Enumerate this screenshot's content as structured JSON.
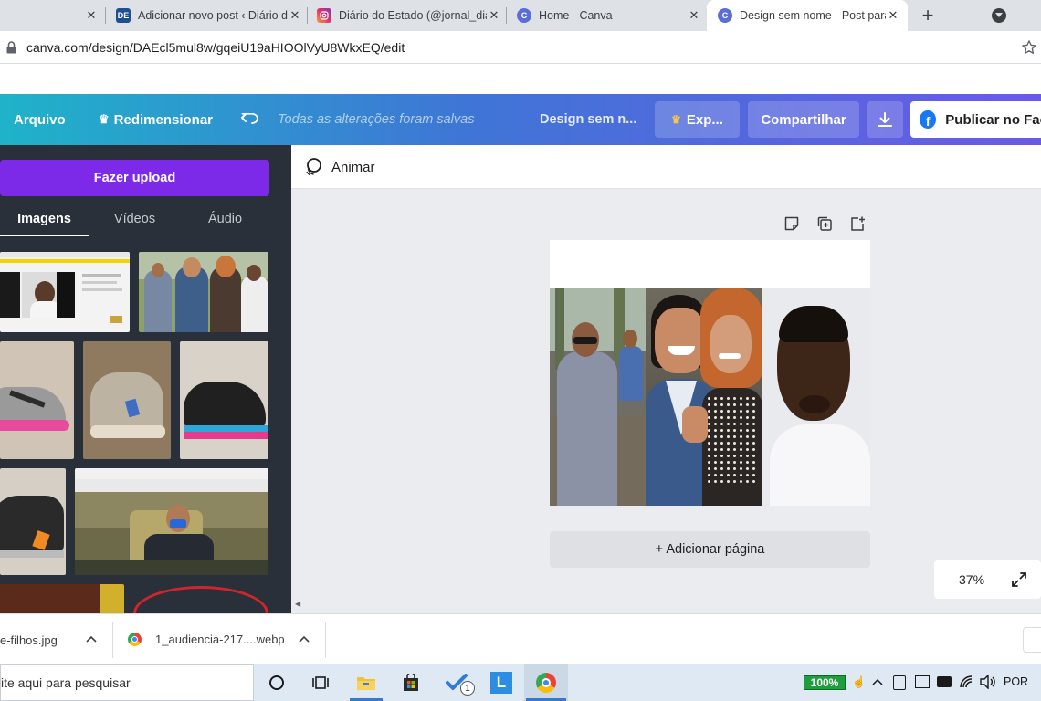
{
  "browser": {
    "tabs": [
      {
        "title": "",
        "favicon": "canva-icon"
      },
      {
        "title": "Adicionar novo post ‹ Diário d",
        "favicon": "de-icon",
        "favicon_text": "DE"
      },
      {
        "title": "Diário do Estado (@jornal_dia",
        "favicon": "instagram-icon"
      },
      {
        "title": "Home - Canva",
        "favicon": "canva-icon"
      },
      {
        "title": "Design sem nome - Post para",
        "favicon": "canva-icon"
      }
    ],
    "new_tab_symbol": "+",
    "address": "canva.com/design/DAEcl5mul8w/gqeiU19aHIOOlVyU8WkxEQ/edit"
  },
  "canva": {
    "file_menu": "Arquivo",
    "resize": "Redimensionar",
    "save_status": "Todas as alterações foram salvas",
    "design_name": "Design sem n...",
    "export": "Exp...",
    "share": "Compartilhar",
    "publish": "Publicar no Fac",
    "upload_button": "Fazer upload",
    "panel_tabs": [
      "Imagens",
      "Vídeos",
      "Áudio"
    ],
    "animate": "Animar",
    "add_page": "+ Adicionar página",
    "zoom": "37%"
  },
  "downloads": [
    {
      "name": "e-filhos.jpg"
    },
    {
      "name": "1_audiencia-217....webp"
    }
  ],
  "taskbar": {
    "search_placeholder": "ite aqui para pesquisar",
    "battery": "100%",
    "language": "POR",
    "todo_badge": "1"
  },
  "colors": {
    "canva_purple": "#7d2ae8",
    "panel_bg": "#293039",
    "header_start": "#1fb3c9",
    "header_end": "#6a5ae6"
  }
}
